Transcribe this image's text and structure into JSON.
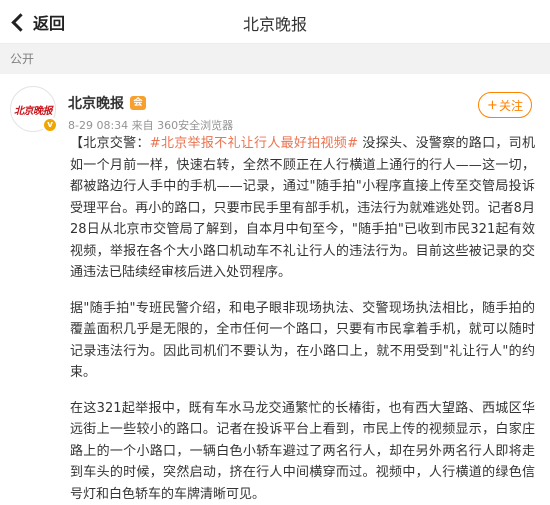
{
  "header": {
    "back_label": "返回",
    "title": "北京晚报"
  },
  "section_label": "公开",
  "post": {
    "author": "北京晚报",
    "avatar_text": "北京晚报",
    "verified_mark": "v",
    "member_badge": "会",
    "meta": "8-29 08:34  来自 360安全浏览器",
    "follow_label": "关注",
    "para1": {
      "prefix": "【北京交警：",
      "topic": "#北京举报不礼让行人最好拍视频#",
      "text": " 没探头、没警察的路口，司机如一个月前一样，快速右转，全然不顾正在人行横道上通行的行人——这一切，都被路边行人手中的手机——记录，通过\"随手拍\"小程序直接上传至交管局投诉受理平台。再小的路口，只要市民手里有部手机，违法行为就难逃处罚。记者8月28日从北京市交管局了解到，自本月中旬至今，\"随手拍\"已收到市民321起有效视频，举报在各个大小路口机动车不礼让行人的违法行为。目前这些被记录的交通违法已陆续经审核后进入处罚程序。"
    },
    "para2": "据\"随手拍\"专班民警介绍，和电子眼非现场执法、交警现场执法相比，随手拍的覆盖面积几乎是无限的，全市任何一个路口，只要有市民拿着手机，就可以随时记录违法行为。因此司机们不要认为，在小路口上，就不用受到\"礼让行人\"的约束。",
    "para3": "在这321起举报中，既有车水马龙交通繁忙的长椿街，也有西大望路、西城区华远街上一些较小的路口。记者在投诉平台上看到，市民上传的视频显示，白家庄路上的一个小路口，一辆白色小轿车避过了两名行人，却在另外两名行人即将走到车头的时候，突然启动，挤在行人中间横穿而过。视频中，人行横道的绿色信号灯和白色轿车的车牌清晰可见。"
  },
  "colors": {
    "topic": "#eb7350",
    "follow": "#ff8200",
    "brand_red": "#c8161e"
  }
}
